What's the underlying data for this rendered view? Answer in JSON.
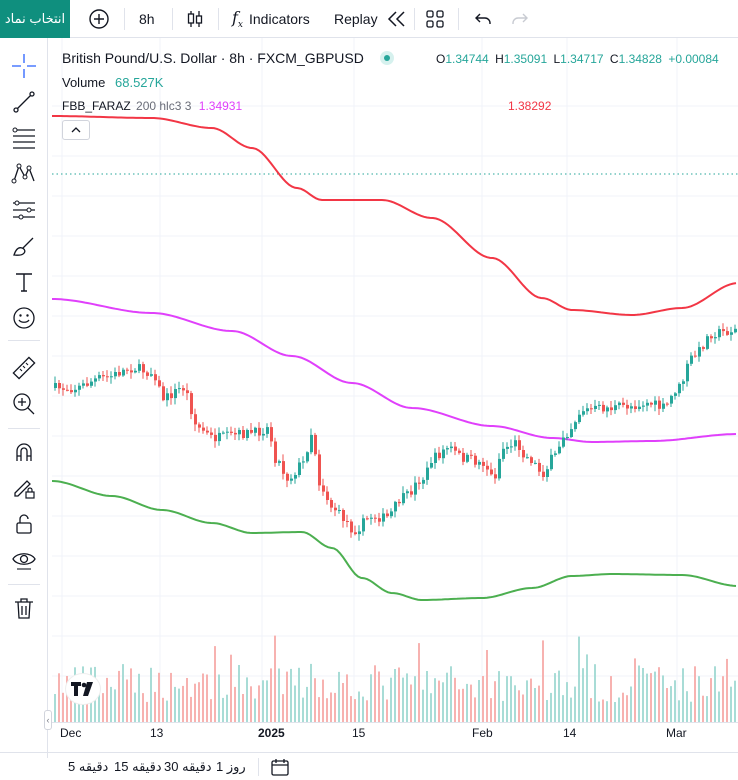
{
  "topbar": {
    "symbol_label": "انتخاب نماد",
    "interval": "8h",
    "indicators_label": "Indicators",
    "replay_label": "Replay"
  },
  "legend": {
    "title": "British Pound/U.S. Dollar · 8h · FXCM_GBPUSD",
    "open_label": "O",
    "open": "1.34744",
    "high_label": "H",
    "high": "1.35091",
    "low_label": "L",
    "low": "1.34717",
    "close_label": "C",
    "close": "1.34828",
    "change": "+0.00084",
    "volume_label": "Volume",
    "volume": "68.527K",
    "indicator_name": "FBB_FARAZ",
    "indicator_params": "200 hlc3 3",
    "indicator_value": "1.34931",
    "indicator_upper": "1.38292",
    "colors": {
      "up": "#26a69a",
      "down": "#ef5350",
      "basis": "#e040fb",
      "upper": "#f23645",
      "lower": "#4caf50",
      "volume_up": "#a8dcd6",
      "volume_down": "#f7b2b0"
    }
  },
  "time_axis": [
    "Dec",
    "13",
    "2025",
    "15",
    "Feb",
    "14",
    "Mar"
  ],
  "bottom_bar": {
    "ranges": [
      {
        "num": "5",
        "unit": "دقیقه"
      },
      {
        "num": "15",
        "unit": "دقیقه"
      },
      {
        "num": "30",
        "unit": "دقیقه"
      },
      {
        "num": "1",
        "unit": "روز"
      }
    ]
  },
  "icons": {
    "left_toolbar": [
      "crosshair-icon",
      "trend-line-icon",
      "fib-icon",
      "pattern-icon",
      "projection-icon",
      "brush-icon",
      "text-icon",
      "emoji-icon",
      "ruler-icon",
      "zoom-icon",
      "magnet-icon",
      "lock-draw-icon",
      "lock-icon",
      "eye-icon",
      "trash-icon"
    ]
  }
}
